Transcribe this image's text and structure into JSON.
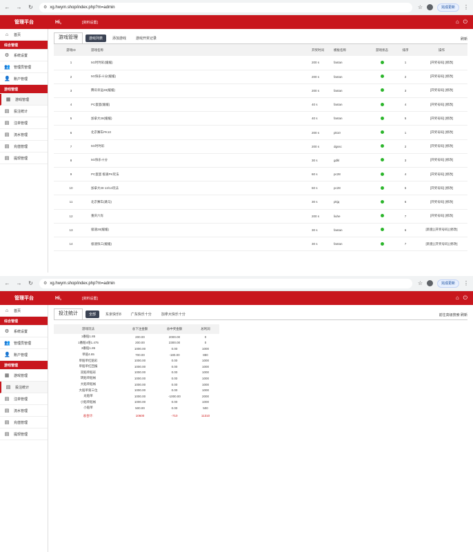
{
  "browser": {
    "url": "xg.hwym.shop/index.php?m=admin",
    "update_label": "完成更新"
  },
  "header": {
    "brand": "管理平台",
    "hi": "Hi,",
    "settings": "[资料设置]"
  },
  "sidebar": {
    "home": "首页",
    "section1": "综合管理",
    "item_site": "系统设置",
    "item_admin": "管理员管理",
    "item_user": "账户管理",
    "section2": "游戏管理",
    "item_game": "游戏管理",
    "item_stats": "投注统计",
    "item_orders": "注单管理",
    "item_flow": "流水管理",
    "item_recharge": "充值管理",
    "item_withdraw": "提现管理"
  },
  "shot1": {
    "title": "游戏管理",
    "tabs": [
      "游戏列表",
      "添加游戏",
      "游戏开奖记录"
    ],
    "right": "刷新",
    "columns": [
      "游戏ID",
      "游戏名称",
      "开奖时间",
      "模板名称",
      "游戏状态",
      "排序",
      "操作"
    ],
    "rows": [
      [
        "1",
        "5G时时彩(缓缓)",
        "200 s",
        "fantan",
        "",
        "1",
        "[开奖号码] [修改]"
      ],
      [
        "2",
        "5G快乐十分(缓缓)",
        "200 s",
        "fantan",
        "",
        "2",
        "[开奖号码] [修改]"
      ],
      [
        "3",
        "腾讯幸运28(缓缓)",
        "200 s",
        "fantan",
        "",
        "3",
        "[开奖号码] [修改]"
      ],
      [
        "4",
        "PC蛋蛋(缓缓)",
        "40 s",
        "fantan",
        "",
        "4",
        "[开奖号码] [修改]"
      ],
      [
        "5",
        "加拿大28(缓缓)",
        "40 s",
        "fantan",
        "",
        "5",
        "[开奖号码] [修改]"
      ],
      [
        "6",
        "北京赛车PK10",
        "200 s",
        "pk10",
        "",
        "1",
        "[开奖号码] [修改]"
      ],
      [
        "7",
        "5G时时彩",
        "200 s",
        "dgssc",
        "",
        "2",
        "[开奖号码] [修改]"
      ],
      [
        "8",
        "5G快乐十分",
        "30 s",
        "gdkl",
        "",
        "3",
        "[开奖号码] [修改]"
      ],
      [
        "9",
        "PC蛋蛋 极速PK玩法",
        "60 s",
        "pc28",
        "",
        "4",
        "[开奖号码] [修改]"
      ],
      [
        "10",
        "加拿大28 13/14玩法",
        "60 s",
        "pc28",
        "",
        "5",
        "[开奖号码] [修改]"
      ],
      [
        "11",
        "北京赛车(跳马)",
        "30 s",
        "pkjq",
        "",
        "6",
        "[开奖号码] [修改]"
      ],
      [
        "12",
        "重庆六肖",
        "200 s",
        "liuhe",
        "",
        "7",
        "[开奖号码] [修改]"
      ],
      [
        "13",
        "极速28(缓缓)",
        "30 s",
        "fantan",
        "",
        "6",
        "[新盘] [开奖号码] [修改]"
      ],
      [
        "14",
        "极速快三(缓缓)",
        "30 s",
        "fantan",
        "",
        "7",
        "[新盘] [开奖号码] [修改]"
      ]
    ]
  },
  "shot2": {
    "title": "投注统计",
    "tabs": [
      "全部",
      "东京快乐8",
      "广东快乐十分",
      "加拿大快乐十分"
    ],
    "right": "前往高级搜索  刷新",
    "columns": [
      "游戏玩法",
      "总下注金额",
      "总中奖金额",
      "总利润"
    ],
    "rows": [
      [
        "1番赔1.85",
        "200.00",
        "2000.00",
        "0"
      ],
      [
        "1番赔4倍1.475",
        "200.00",
        "2300.00",
        "0"
      ],
      [
        "3番赔1.85",
        "1000.00",
        "0.00",
        "1000"
      ],
      [
        "单赔4.85",
        "700.00",
        "-180.00",
        "880"
      ],
      [
        "单赔单红赔彩",
        "1000.00",
        "0.00",
        "1000"
      ],
      [
        "单赔单红回报",
        "1000.00",
        "0.00",
        "1000"
      ],
      [
        "双赔单赔彩",
        "1000.00",
        "0.00",
        "1000"
      ],
      [
        "转赔单赔帐",
        "1000.00",
        "0.00",
        "1000"
      ],
      [
        "大赔单赔帐",
        "1000.00",
        "0.00",
        "1000"
      ],
      [
        "大赔单第三位",
        "1000.00",
        "0.00",
        "1000"
      ],
      [
        "龙赔单",
        "1000.00",
        "-1000.00",
        "2000"
      ],
      [
        "小赔单赔帐",
        "1000.00",
        "0.00",
        "1000"
      ],
      [
        "小赔单",
        "500.00",
        "0.00",
        "500"
      ]
    ],
    "total": [
      "总合计:",
      "10600",
      "-710",
      "11310"
    ]
  }
}
